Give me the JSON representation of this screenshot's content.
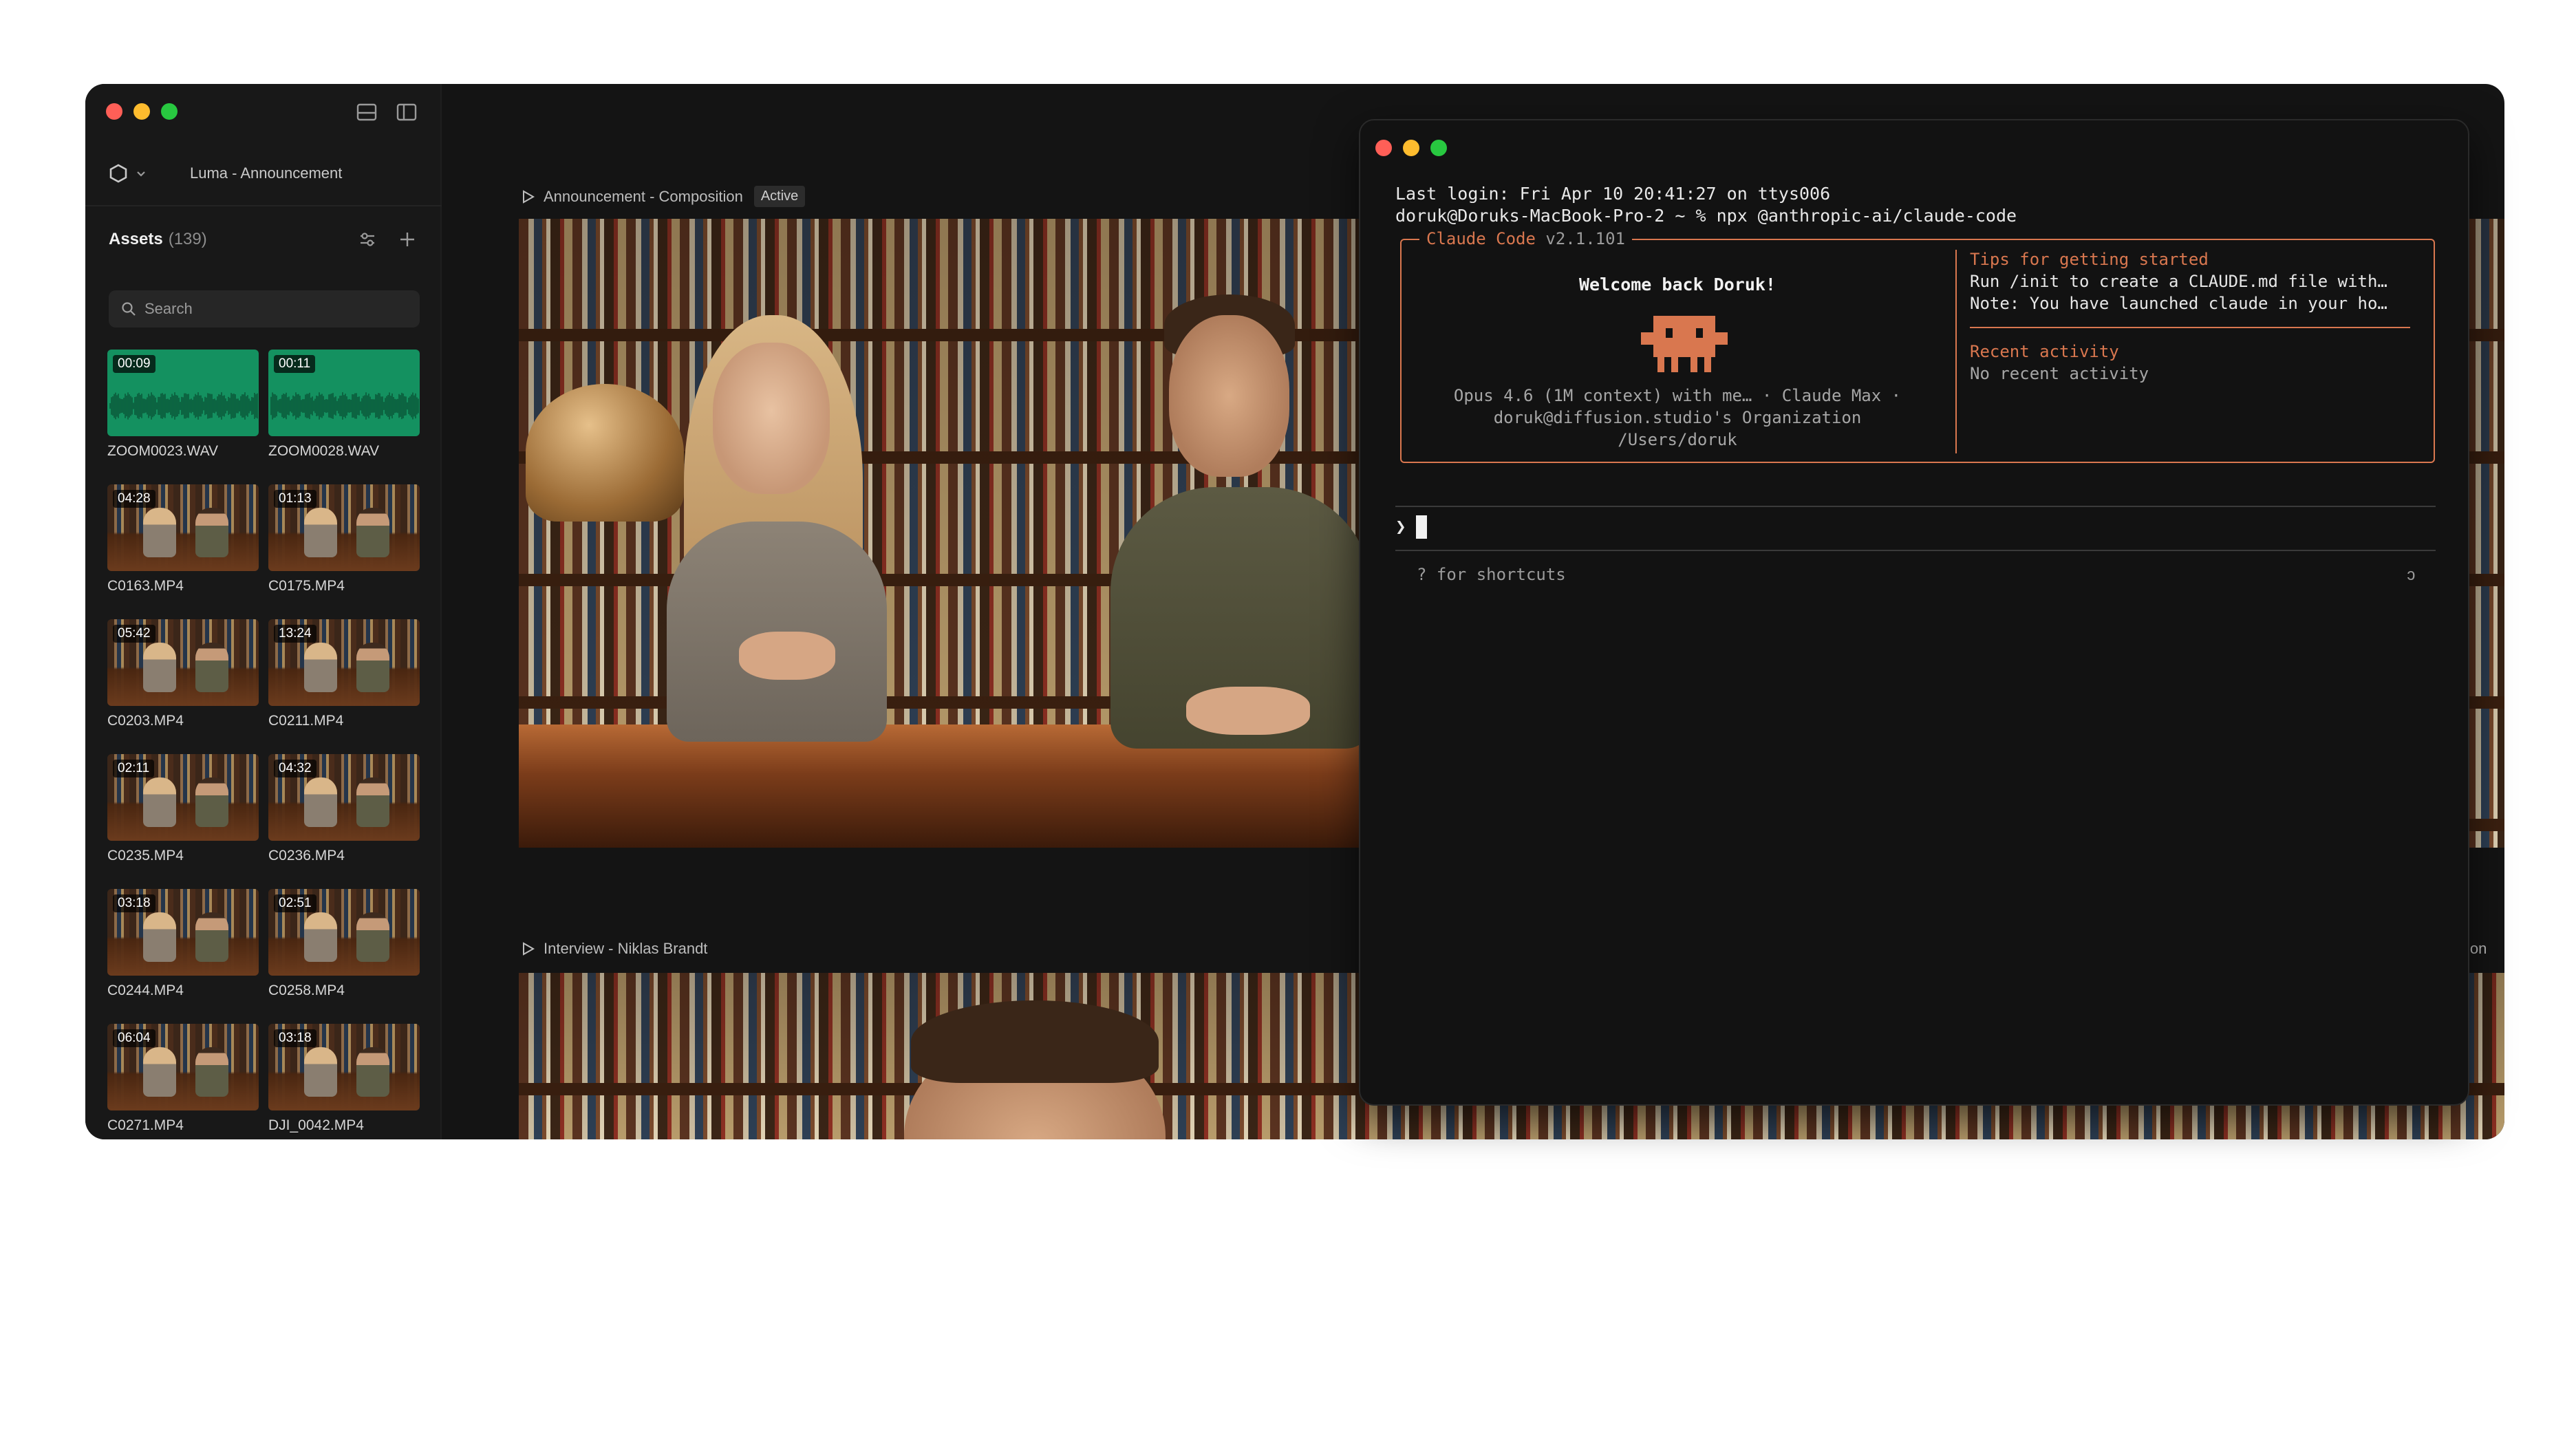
{
  "editor": {
    "project_name": "Luma - Announcement",
    "assets_title": "Assets",
    "assets_count": "(139)",
    "search_placeholder": "Search",
    "assets": [
      {
        "duration": "00:09",
        "name": "ZOOM0023.WAV",
        "kind": "audio"
      },
      {
        "duration": "00:11",
        "name": "ZOOM0028.WAV",
        "kind": "audio"
      },
      {
        "duration": "04:28",
        "name": "C0163.MP4",
        "kind": "video"
      },
      {
        "duration": "01:13",
        "name": "C0175.MP4",
        "kind": "video"
      },
      {
        "duration": "05:42",
        "name": "C0203.MP4",
        "kind": "video"
      },
      {
        "duration": "13:24",
        "name": "C0211.MP4",
        "kind": "video"
      },
      {
        "duration": "02:11",
        "name": "C0235.MP4",
        "kind": "video"
      },
      {
        "duration": "04:32",
        "name": "C0236.MP4",
        "kind": "video"
      },
      {
        "duration": "03:18",
        "name": "C0244.MP4",
        "kind": "video"
      },
      {
        "duration": "02:51",
        "name": "C0258.MP4",
        "kind": "video"
      },
      {
        "duration": "06:04",
        "name": "C0271.MP4",
        "kind": "video"
      },
      {
        "duration": "03:18",
        "name": "DJI_0042.MP4",
        "kind": "video"
      }
    ],
    "compositions": [
      {
        "label": "Announcement - Composition",
        "badge": "Active"
      },
      {
        "label": "Interview - Niklas Brandt",
        "badge": ""
      }
    ],
    "clipped_label": "ition"
  },
  "terminal": {
    "last_login": "Last login: Fri Apr 10 20:41:27 on ttys006",
    "command": "doruk@Doruks-MacBook-Pro-2 ~ % npx @anthropic-ai/claude-code",
    "app_name": "Claude Code",
    "version": "v2.1.101",
    "welcome": "Welcome back Doruk!",
    "model_line": "Opus 4.6 (1M context) with me… · Claude Max ·",
    "org_line": "doruk@diffusion.studio's Organization",
    "cwd": "/Users/doruk",
    "tips_title": "Tips for getting started",
    "tips": [
      "Run /init to create a CLAUDE.md file with…",
      "Note: You have launched claude in your ho…"
    ],
    "recent_title": "Recent activity",
    "recent_text": "No recent activity",
    "prompt_symbol": "❯",
    "shortcuts_hint": "? for shortcuts",
    "hint_right": "ↄ"
  },
  "colors": {
    "accent": "#d9774f",
    "audio_thumb": "#149160",
    "traffic_red": "#ff5f57",
    "traffic_yellow": "#febc2e",
    "traffic_green": "#28c840"
  },
  "icons": [
    "hexagon-logo-icon",
    "chevron-down-icon",
    "panel-bottom-icon",
    "sidebar-icon",
    "filter-sliders-icon",
    "plus-icon",
    "search-icon",
    "play-icon",
    "claude-mascot-icon"
  ]
}
